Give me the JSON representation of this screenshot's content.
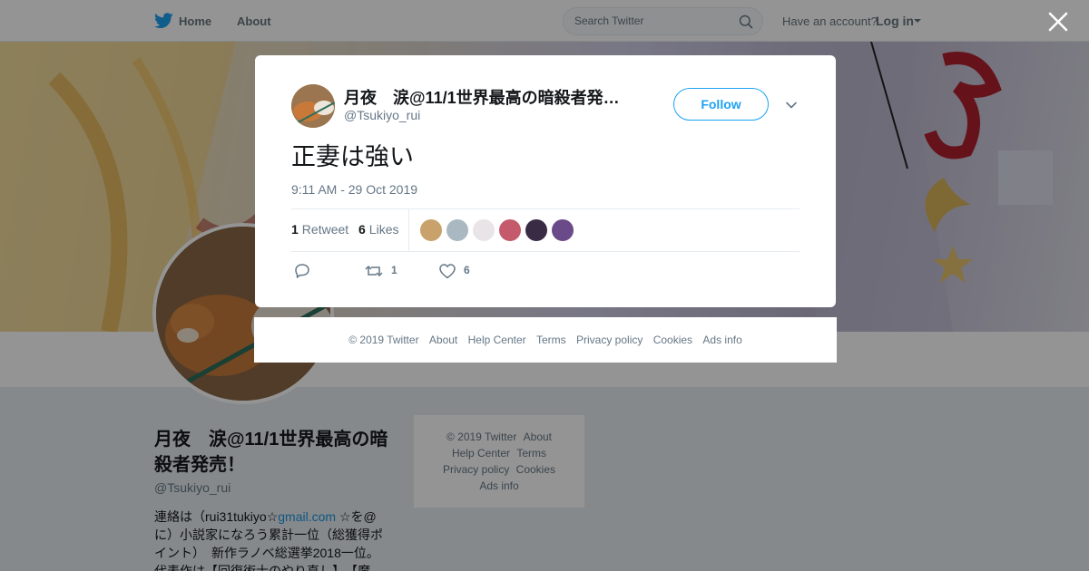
{
  "nav": {
    "home": "Home",
    "about": "About",
    "search_placeholder": "Search Twitter",
    "have_account": "Have an account?",
    "login": "Log in"
  },
  "profile": {
    "name": "月夜　涙@11/1世界最高の暗殺者発売！",
    "handle": "@Tsukiyo_rui",
    "bio_prefix": "連絡は（rui31tukiyo☆",
    "bio_link": "gmail.com",
    "bio_rest": " ☆を@に）小説家になろう累計一位（総獲得ポイント）　新作ラノベ総選挙2018一位。代表作は【回復術士のやり直し】、【魔"
  },
  "side_footer": {
    "items": [
      "© 2019 Twitter",
      "About",
      "Help Center",
      "Terms",
      "Privacy policy",
      "Cookies",
      "Ads info"
    ]
  },
  "tweet": {
    "author_name": "月夜　涙@11/1世界最高の暗殺者発売！",
    "author_handle": "@Tsukiyo_rui",
    "follow_label": "Follow",
    "text": "正妻は強い",
    "timestamp": "9:11 AM - 29 Oct 2019",
    "retweet_count": "1",
    "retweet_label": "Retweet",
    "like_count": "6",
    "like_label": "Likes",
    "action_retweets": "1",
    "action_likes": "6",
    "likers": [
      {
        "icon": "liker-avatar",
        "color": "#c9a26b"
      },
      {
        "icon": "default-avatar",
        "color": "#aab8c2"
      },
      {
        "icon": "liker-avatar",
        "color": "#e8e4e8"
      },
      {
        "icon": "liker-avatar",
        "color": "#c45a6b"
      },
      {
        "icon": "liker-avatar",
        "color": "#3a2b44"
      },
      {
        "icon": "liker-avatar",
        "color": "#6b4a8a"
      }
    ]
  },
  "modal_footer": {
    "items": [
      "© 2019 Twitter",
      "About",
      "Help Center",
      "Terms",
      "Privacy policy",
      "Cookies",
      "Ads info"
    ]
  },
  "colors": {
    "brand_blue": "#1da1f2",
    "link_blue": "#1b95e0",
    "muted": "#657786"
  }
}
